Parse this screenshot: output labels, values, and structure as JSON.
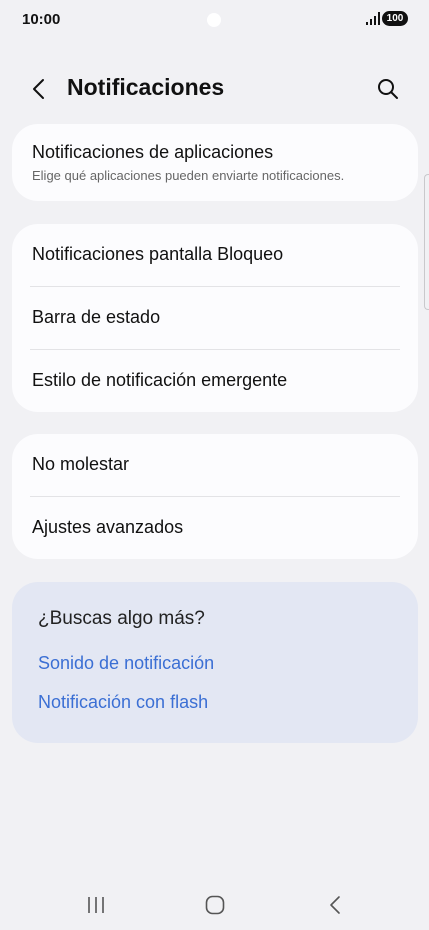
{
  "status_bar": {
    "time": "10:00",
    "battery": "100",
    "icons": [
      "signal-icon",
      "battery-icon"
    ]
  },
  "header": {
    "title": "Notificaciones",
    "back_icon": "back-arrow-icon",
    "search_icon": "search-icon"
  },
  "app_notifications": {
    "title": "Notificaciones de aplicaciones",
    "subtitle": "Elige qué aplicaciones pueden enviarte notificaciones."
  },
  "group_1": {
    "items": [
      {
        "label": "Notificaciones pantalla Bloqueo"
      },
      {
        "label": "Barra de estado"
      },
      {
        "label": "Estilo de notificación emergente"
      }
    ]
  },
  "group_2": {
    "items": [
      {
        "label": "No molestar"
      },
      {
        "label": "Ajustes avanzados"
      }
    ]
  },
  "suggestions": {
    "title": "¿Buscas algo más?",
    "links": [
      {
        "label": "Sonido de notificación"
      },
      {
        "label": "Notificación con flash"
      }
    ],
    "link_color": "#3b6fd4"
  },
  "nav_bar": {
    "icons": [
      "recent-apps-icon",
      "home-icon",
      "back-icon"
    ]
  }
}
